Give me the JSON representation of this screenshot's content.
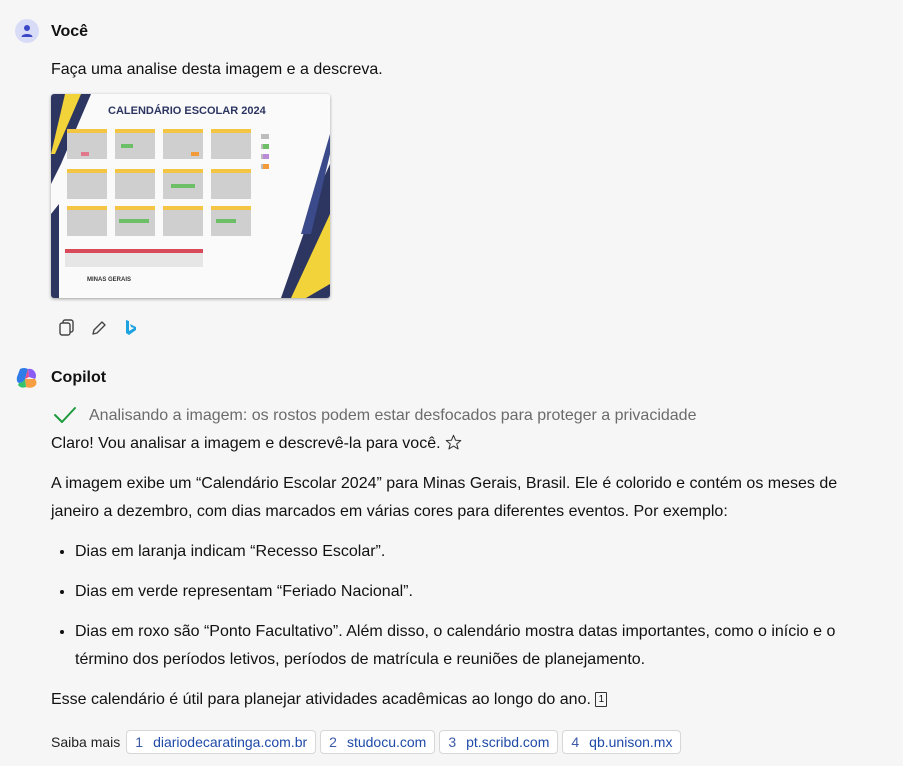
{
  "user": {
    "name": "Você",
    "message": "Faça uma analise desta imagem e a descreva.",
    "image_alt": "CALENDÁRIO ESCOLAR 2024",
    "image_title": "CALENDÁRIO ESCOLAR 2024",
    "image_logo": "MINAS GERAIS",
    "actions": [
      "copy-icon",
      "pencil-icon",
      "bing-icon"
    ]
  },
  "copilot": {
    "name": "Copilot",
    "status": "Analisando a imagem: os rostos podem estar desfocados para proteger a privacidade",
    "intro": "Claro! Vou analisar a imagem e descrevê-la para você.",
    "paragraph1": "A imagem exibe um “Calendário Escolar 2024” para Minas Gerais, Brasil. Ele é colorido e contém os meses de janeiro a dezembro, com dias marcados em várias cores para diferentes eventos. Por exemplo:",
    "bullets": [
      "Dias em laranja indicam “Recesso Escolar”.",
      "Dias em verde representam “Feriado Nacional”.",
      "Dias em roxo são “Ponto Facultativo”. Além disso, o calendário mostra datas importantes, como o início e o término dos períodos letivos, períodos de matrícula e reuniões de planejamento."
    ],
    "closing": "Esse calendário é útil para planejar atividades acadêmicas ao longo do ano.",
    "footnote": "1",
    "learn_more_label": "Saiba mais",
    "sources": [
      {
        "num": "1",
        "label": "diariodecaratinga.com.br"
      },
      {
        "num": "2",
        "label": "studocu.com"
      },
      {
        "num": "3",
        "label": "pt.scribd.com"
      },
      {
        "num": "4",
        "label": "qb.unison.mx"
      }
    ]
  }
}
